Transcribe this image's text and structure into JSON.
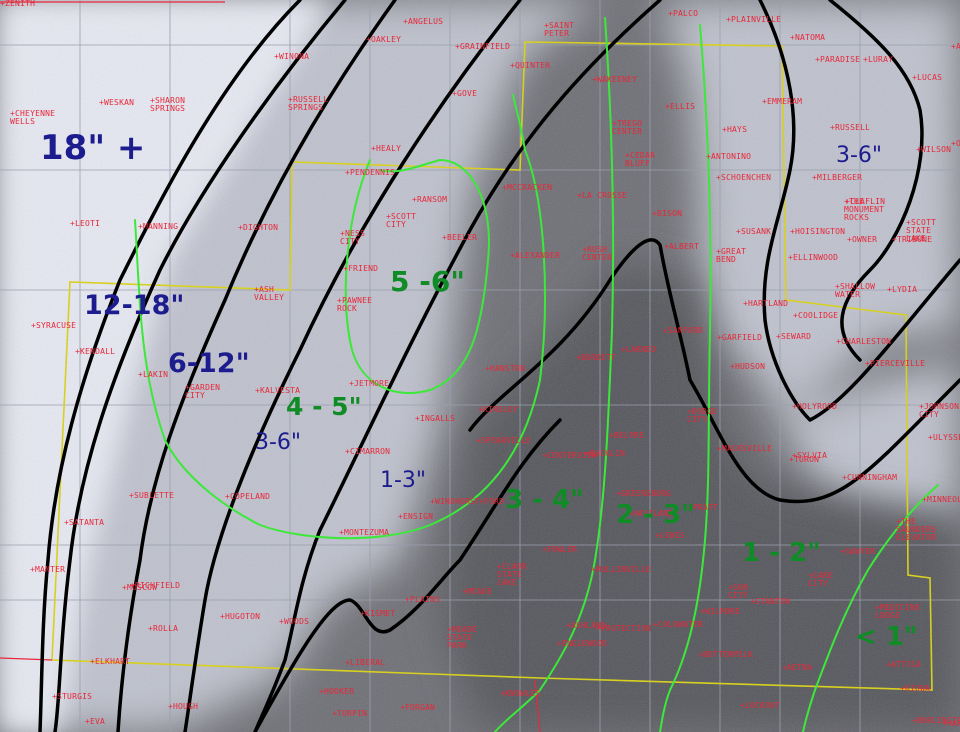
{
  "map": {
    "colors": {
      "snow_bright": "#e7e9f3",
      "snow_light": "#bfc2ce",
      "ground": "#6e6f75",
      "ground_dark": "#55565c",
      "county_lines": "#9aa0ad",
      "state_border": "#d8d020",
      "observed_contours": "#000000",
      "forecast_contours": "#3ce83a",
      "observed_labels": "#1c1c8e",
      "forecast_labels": "#0f8c25",
      "town_labels": "#e8283a"
    },
    "observed_zones": [
      {
        "label": "18\" +"
      },
      {
        "label": "12-18\""
      },
      {
        "label": "6-12\""
      },
      {
        "label": "3-6\""
      },
      {
        "label": "1-3\""
      },
      {
        "label": "3-6\""
      }
    ],
    "forecast_zones": [
      {
        "label": "5 -6\""
      },
      {
        "label": "4 - 5\""
      },
      {
        "label": "3 - 4\""
      },
      {
        "label": "2 - 3\""
      },
      {
        "label": "1 - 2\""
      },
      {
        "label": "< 1\""
      }
    ],
    "towns": [
      "ANGELUS",
      "OAKLEY",
      "GRAINFIELD",
      "QUINTER",
      "SAINT\nPETER",
      "PALCO",
      "PLAINVILLE",
      "NATOMA",
      "PARADISE",
      "LURAY",
      "LUCAS",
      "WINONA",
      "CHEYENNE\nWELLS",
      "WESKAN",
      "SHARON\nSPRINGS",
      "RUSSELL\nSPRINGS",
      "GOVE",
      "WAKEENEY",
      "ELLIS",
      "EMMERAM",
      "HAYS",
      "RUSSELL",
      "WILSON",
      "TREGO\nCENTER",
      "CEDAR\nBLUFF",
      "ANTONINO",
      "SCHOENCHEN",
      "MILBERGER",
      "THE\nMONUMENT\nROCKS",
      "SCOTT\nSTATE\nLAKE",
      "HEALY",
      "PENDENNIS",
      "RANSOM",
      "MCCRACKEN",
      "LA CROSSE",
      "BISON",
      "SUSANK",
      "HOISINGTON",
      "CLAFLIN",
      "OWNER",
      "TRIBUNE",
      "LEOTI",
      "MANNING",
      "DIGHTON",
      "SCOTT\nCITY",
      "BEELER",
      "NESS\nCITY",
      "ALEXANDER",
      "RUSH\nCENTER",
      "ALBERT",
      "GREAT\nBEND",
      "ELLINWOOD",
      "SHALLOW\nWATER",
      "LYDIA",
      "FRIEND",
      "ASH\nVALLEY",
      "PAWNEE\nROCK",
      "HARTLAND",
      "COOLIDGE",
      "SYRACUSE",
      "KENDALL",
      "LAKIN",
      "GARDEN\nCITY",
      "KALVESTA",
      "JETMORE",
      "HANSTON",
      "BURDETT",
      "LARNED",
      "SANFORD",
      "GARFIELD",
      "SEWARD",
      "HUDSON",
      "CHARLESTON",
      "PIERCEVILLE",
      "INGALLS",
      "KINSLEY",
      "CIMARRON",
      "DODGE\nCITY",
      "SPEARVILLE",
      "CENTERVIEW",
      "BELPRE",
      "MACKSVILLE",
      "SYLVIA",
      "HOLYROOD",
      "JOHNSON\nCITY",
      "ULYSSES",
      "SUBLETTE",
      "COPELAND",
      "MONTEZUMA",
      "ENSIGN",
      "WINDHORST",
      "FORD",
      "BUCKLIN",
      "GREENSBURG",
      "HAVILAND",
      "PRATT",
      "TURON",
      "CUNNINGHAM",
      "THE\nSAUNDERS\nELEVATOR",
      "SATANTA",
      "MINNEOLA",
      "FOWLER",
      "CLARK\nSTATE\nLAKE",
      "MULLINVILLE",
      "LEWIS",
      "SAWYER",
      "MEADE",
      "ASHLAND",
      "PROTECTION",
      "COLDWATER",
      "WILMORE",
      "SUN\nCITY",
      "LAKE\nCITY",
      "STANTON",
      "MANTER",
      "RICHFIELD",
      "MOSCOW",
      "ROLLA",
      "HUGOTON",
      "WOODS",
      "PLAINS",
      "KISMET",
      "MEADE\nSTATE\nPARK",
      "ENGLEWOOD",
      "KNOWLES",
      "BUTTERMILK",
      "AETNA",
      "KIOWA",
      "ELKHART",
      "LIBERAL",
      "HOOKER",
      "FORGAN",
      "TURPIN",
      "LOCKOUT",
      "HOUGH",
      "STURGIS",
      "EVA",
      "MEDICINE\nLODGE",
      "ATTICA",
      "HARDTNER",
      "BURLINGTON",
      "ALTUS",
      "ORIENT",
      "ZENITH"
    ]
  }
}
